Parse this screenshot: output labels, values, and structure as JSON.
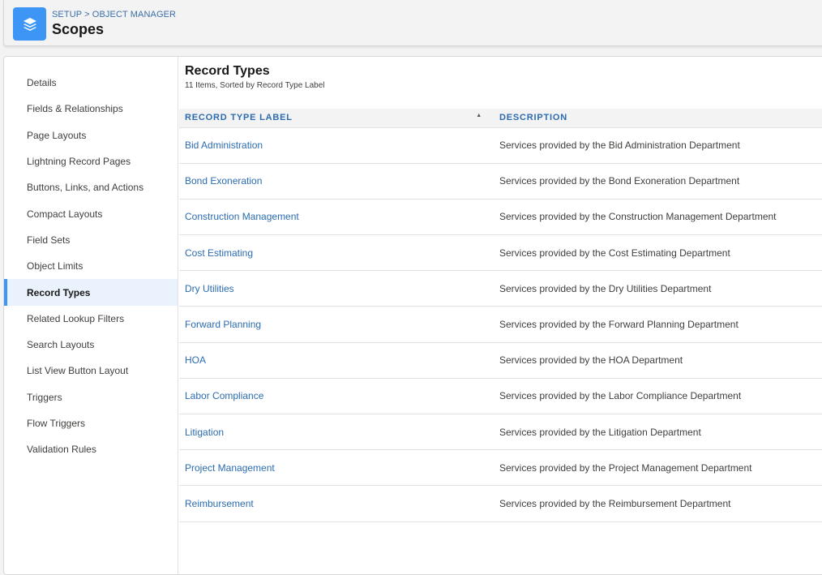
{
  "header": {
    "breadcrumb": "SETUP > OBJECT MANAGER",
    "title": "Scopes",
    "icon": "layers-icon",
    "icon_color": "#3d96f5"
  },
  "sidebar": {
    "items": [
      {
        "label": "Details"
      },
      {
        "label": "Fields & Relationships"
      },
      {
        "label": "Page Layouts"
      },
      {
        "label": "Lightning Record Pages"
      },
      {
        "label": "Buttons, Links, and Actions"
      },
      {
        "label": "Compact Layouts"
      },
      {
        "label": "Field Sets"
      },
      {
        "label": "Object Limits"
      },
      {
        "label": "Record Types",
        "active": true
      },
      {
        "label": "Related Lookup Filters"
      },
      {
        "label": "Search Layouts"
      },
      {
        "label": "List View Button Layout"
      },
      {
        "label": "Triggers"
      },
      {
        "label": "Flow Triggers"
      },
      {
        "label": "Validation Rules"
      }
    ]
  },
  "main": {
    "title": "Record Types",
    "subtitle": "11 Items, Sorted by Record Type Label",
    "columns": {
      "label": "RECORD TYPE LABEL",
      "description": "DESCRIPTION",
      "sort_icon": "sort-ascending-icon"
    },
    "rows": [
      {
        "label": "Bid Administration",
        "description": "Services provided by the Bid Administration Department"
      },
      {
        "label": "Bond Exoneration",
        "description": "Services provided by the Bond Exoneration Department"
      },
      {
        "label": "Construction Management",
        "description": "Services provided by the Construction Management Department"
      },
      {
        "label": "Cost Estimating",
        "description": "Services provided by the Cost Estimating Department"
      },
      {
        "label": "Dry Utilities",
        "description": "Services provided by the Dry Utilities Department"
      },
      {
        "label": "Forward Planning",
        "description": "Services provided by the Forward Planning Department"
      },
      {
        "label": "HOA",
        "description": "Services provided by the HOA Department"
      },
      {
        "label": "Labor Compliance",
        "description": "Services provided by the Labor Compliance Department"
      },
      {
        "label": "Litigation",
        "description": "Services provided by the Litigation Department"
      },
      {
        "label": "Project Management",
        "description": "Services provided by the Project Management Department"
      },
      {
        "label": "Reimbursement",
        "description": "Services provided by the Reimbursement Department"
      }
    ]
  }
}
